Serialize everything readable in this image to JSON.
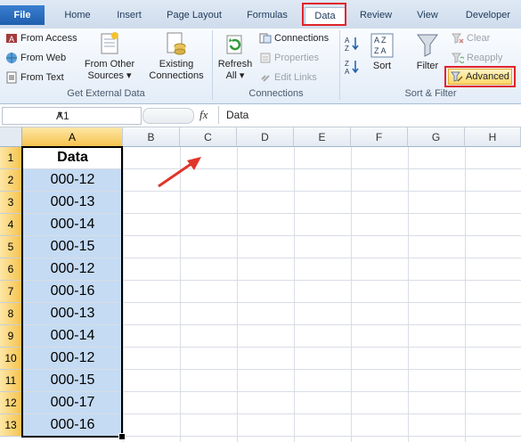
{
  "tabs": [
    {
      "label": "File"
    },
    {
      "label": "Home"
    },
    {
      "label": "Insert"
    },
    {
      "label": "Page Layout"
    },
    {
      "label": "Formulas"
    },
    {
      "label": "Data"
    },
    {
      "label": "Review"
    },
    {
      "label": "View"
    },
    {
      "label": "Developer"
    }
  ],
  "ribbon": {
    "get_external": {
      "from_access": "From Access",
      "from_web": "From Web",
      "from_text": "From Text",
      "from_other_line1": "From Other",
      "from_other_line2": "Sources",
      "existing_line1": "Existing",
      "existing_line2": "Connections",
      "group_label": "Get External Data"
    },
    "connections": {
      "refresh_line1": "Refresh",
      "refresh_line2": "All",
      "connections": "Connections",
      "properties": "Properties",
      "edit_links": "Edit Links",
      "group_label": "Connections"
    },
    "sort_filter": {
      "sort": "Sort",
      "filter": "Filter",
      "clear": "Clear",
      "reapply": "Reapply",
      "advanced": "Advanced",
      "group_label": "Sort & Filter"
    }
  },
  "formula_bar": {
    "name_box": "A1",
    "fx": "fx",
    "content": "Data"
  },
  "columns": [
    "A",
    "B",
    "C",
    "D",
    "E",
    "F",
    "G",
    "H"
  ],
  "rows": [
    "1",
    "2",
    "3",
    "4",
    "5",
    "6",
    "7",
    "8",
    "9",
    "10",
    "11",
    "12",
    "13"
  ],
  "cells": {
    "header": "Data",
    "values": [
      "000-12",
      "000-13",
      "000-14",
      "000-15",
      "000-12",
      "000-16",
      "000-13",
      "000-14",
      "000-12",
      "000-15",
      "000-17",
      "000-16"
    ]
  },
  "colors": {
    "highlight": "#e0232b",
    "selection_fill": "#c5dbf3",
    "accent": "#1f5fae"
  }
}
